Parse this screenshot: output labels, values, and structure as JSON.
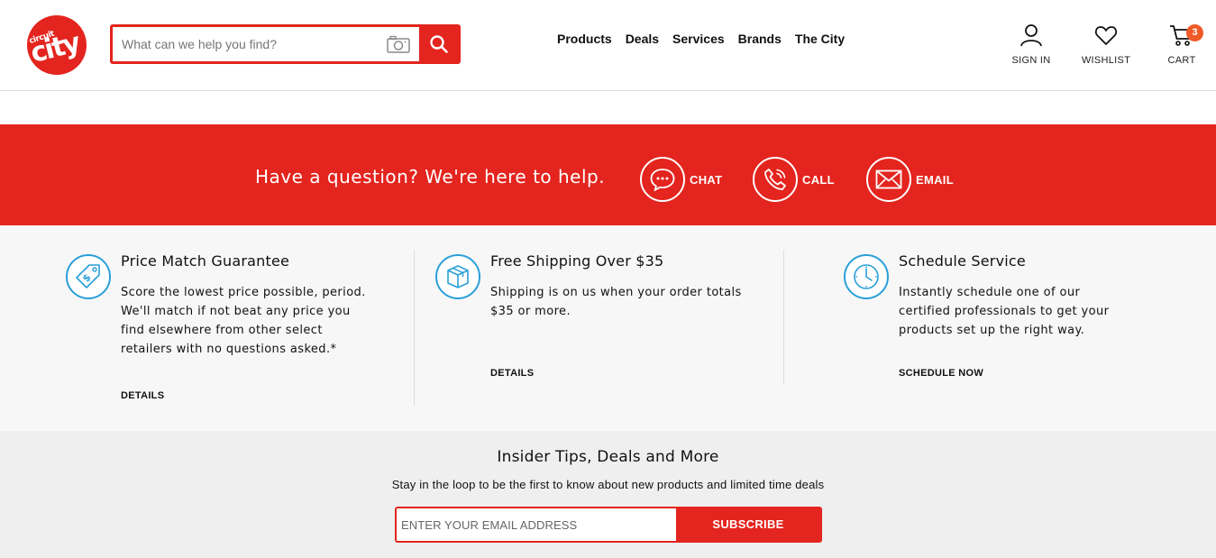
{
  "header": {
    "logo": {
      "small_text": "circuit",
      "big_text": "city"
    },
    "search": {
      "placeholder": "What can we help you find?"
    },
    "nav": [
      {
        "label": "Products"
      },
      {
        "label": "Deals"
      },
      {
        "label": "Services"
      },
      {
        "label": "Brands"
      },
      {
        "label": "The City"
      }
    ],
    "account": {
      "signin_label": "SIGN IN",
      "wishlist_label": "WISHLIST",
      "cart_label": "CART",
      "cart_count": "3"
    }
  },
  "help": {
    "text": "Have a question? We're here to help.",
    "options": [
      {
        "label": "CHAT",
        "icon": "chat-bubble-icon"
      },
      {
        "label": "CALL",
        "icon": "phone-icon"
      },
      {
        "label": "EMAIL",
        "icon": "envelope-icon"
      }
    ]
  },
  "features": [
    {
      "title": "Price Match Guarantee",
      "description": "Score the lowest price possible, period. We'll match if not beat any price you find elsewhere from other select retailers with no questions asked.*",
      "link": "DETAILS",
      "icon": "price-tag-icon"
    },
    {
      "title": "Free Shipping Over $35",
      "description": "Shipping is on us when your order totals $35 or more.",
      "link": "DETAILS",
      "icon": "package-box-icon"
    },
    {
      "title": "Schedule Service",
      "description": "Instantly schedule one of our certified professionals to get your products set up the right way.",
      "link": "SCHEDULE NOW",
      "icon": "clock-icon"
    }
  ],
  "newsletter": {
    "title": "Insider Tips, Deals and More",
    "subtitle": "Stay in the loop to be the first to know about new products and limited time deals",
    "placeholder": "ENTER YOUR EMAIL ADDRESS",
    "button": "SUBSCRIBE"
  },
  "colors": {
    "brand_red": "#e4241e",
    "accent_blue": "#2a9fd8",
    "badge_orange": "#f05a28"
  }
}
